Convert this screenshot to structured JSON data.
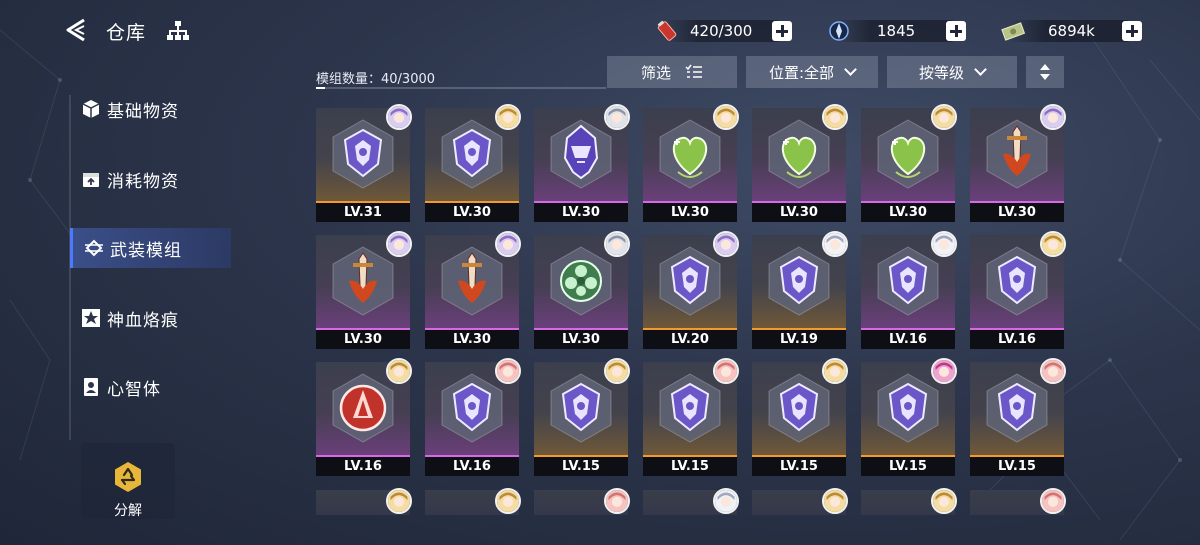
{
  "header": {
    "title": "仓库",
    "resources": [
      {
        "icon": "stamina-battery-icon",
        "value": "420/300"
      },
      {
        "icon": "crystal-icon",
        "value": "1845"
      },
      {
        "icon": "money-icon",
        "value": "6894k"
      }
    ]
  },
  "nav": {
    "items": [
      {
        "label": "基础物资",
        "icon": "cube-icon",
        "active": false
      },
      {
        "label": "消耗物资",
        "icon": "box-icon",
        "active": false
      },
      {
        "label": "武装模组",
        "icon": "weapon-module-icon",
        "active": true
      },
      {
        "label": "神血烙痕",
        "icon": "star-sigil-icon",
        "active": false
      },
      {
        "label": "心智体",
        "icon": "profile-card-icon",
        "active": false
      }
    ],
    "decompose_label": "分解"
  },
  "toolbar": {
    "count_label": "模组数量：40/3000",
    "filter_label": "筛选",
    "location_label": "位置:全部",
    "sort_label": "按等级"
  },
  "colors": {
    "orange_rarity": "#f29a2e",
    "pink_rarity": "#d66ae6",
    "accent_blue": "#4b79ff"
  },
  "modules": [
    {
      "level": "LV.31",
      "rarity": "orange",
      "emblem": "purple-shield",
      "avatar": "lilac"
    },
    {
      "level": "LV.30",
      "rarity": "orange",
      "emblem": "purple-shield",
      "avatar": "blonde"
    },
    {
      "level": "LV.30",
      "rarity": "pink",
      "emblem": "purple-helm",
      "avatar": "silver"
    },
    {
      "level": "LV.30",
      "rarity": "pink",
      "emblem": "green-heart",
      "avatar": "blonde"
    },
    {
      "level": "LV.30",
      "rarity": "pink",
      "emblem": "green-heart",
      "avatar": "blonde"
    },
    {
      "level": "LV.30",
      "rarity": "pink",
      "emblem": "green-heart",
      "avatar": "blonde"
    },
    {
      "level": "LV.30",
      "rarity": "pink",
      "emblem": "red-sword",
      "avatar": "lilac"
    },
    {
      "level": "LV.30",
      "rarity": "pink",
      "emblem": "red-sword",
      "avatar": "lilac"
    },
    {
      "level": "LV.30",
      "rarity": "pink",
      "emblem": "red-sword",
      "avatar": "lilac"
    },
    {
      "level": "LV.30",
      "rarity": "pink",
      "emblem": "green-flower",
      "avatar": "silver"
    },
    {
      "level": "LV.20",
      "rarity": "orange",
      "emblem": "purple-shield",
      "avatar": "lilac"
    },
    {
      "level": "LV.19",
      "rarity": "orange",
      "emblem": "purple-shield",
      "avatar": "white"
    },
    {
      "level": "LV.16",
      "rarity": "pink",
      "emblem": "purple-shield",
      "avatar": "white"
    },
    {
      "level": "LV.16",
      "rarity": "pink",
      "emblem": "purple-shield",
      "avatar": "blonde"
    },
    {
      "level": "LV.16",
      "rarity": "pink",
      "emblem": "red-flame",
      "avatar": "blonde"
    },
    {
      "level": "LV.16",
      "rarity": "pink",
      "emblem": "purple-shield",
      "avatar": "pink"
    },
    {
      "level": "LV.15",
      "rarity": "orange",
      "emblem": "purple-shield",
      "avatar": "blonde"
    },
    {
      "level": "LV.15",
      "rarity": "orange",
      "emblem": "purple-shield",
      "avatar": "pink"
    },
    {
      "level": "LV.15",
      "rarity": "orange",
      "emblem": "purple-shield",
      "avatar": "blonde"
    },
    {
      "level": "LV.15",
      "rarity": "orange",
      "emblem": "purple-shield",
      "avatar": "magenta"
    },
    {
      "level": "LV.15",
      "rarity": "orange",
      "emblem": "purple-shield",
      "avatar": "pink"
    }
  ],
  "partial_row_avatars": [
    "blonde",
    "blonde",
    "pink",
    "white",
    "blonde",
    "blonde",
    "pink"
  ]
}
